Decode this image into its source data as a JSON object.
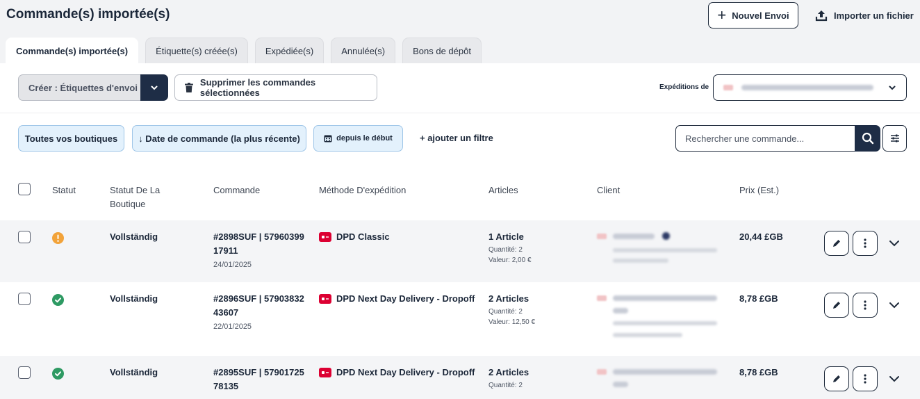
{
  "header": {
    "title": "Commande(s) importée(s)",
    "new_shipment": "Nouvel Envoi",
    "import_file": "Importer un fichier"
  },
  "tabs": [
    {
      "label": "Commande(s) importée(s)",
      "active": true
    },
    {
      "label": "Étiquette(s) créée(s)",
      "active": false
    },
    {
      "label": "Expédiée(s)",
      "active": false
    },
    {
      "label": "Annulée(s)",
      "active": false
    },
    {
      "label": "Bons de dépôt",
      "active": false
    }
  ],
  "toolbar": {
    "create_label": "Créer : Étiquettes d'envoi",
    "delete_label": "Supprimer les commandes sélectionnées",
    "shipments_from_label": "Expéditions de"
  },
  "filters": {
    "shops": "Toutes vos boutiques",
    "sort": "↓ Date de commande (la plus récente)",
    "since": "depuis le début",
    "add_filter": "+ ajouter un filtre",
    "search_placeholder": "Rechercher une commande..."
  },
  "table": {
    "headers": {
      "status": "Statut",
      "shop_status_line1": "Statut De La",
      "shop_status_line2": "Boutique",
      "order": "Commande",
      "shipping_method": "Méthode D'expédition",
      "articles": "Articles",
      "client": "Client",
      "price": "Prix (Est.)"
    },
    "rows": [
      {
        "status": "warning",
        "shop_status": "Vollständig",
        "order_line1": "#2898SUF | 57960399",
        "order_line2": "17911",
        "date": "24/01/2025",
        "method": "DPD Classic",
        "articles": "1 Article",
        "quantity": "Quantité: 2",
        "value": "Valeur: 2,00 €",
        "price": "20,44 £GB"
      },
      {
        "status": "ok",
        "shop_status": "Vollständig",
        "order_line1": "#2896SUF | 57903832",
        "order_line2": "43607",
        "date": "22/01/2025",
        "method": "DPD Next Day Delivery - Dropoff",
        "articles": "2 Articles",
        "quantity": "Quantité: 2",
        "value": "Valeur: 12,50 €",
        "price": "8,78 £GB"
      },
      {
        "status": "ok",
        "shop_status": "Vollständig",
        "order_line1": "#2895SUF | 57901725",
        "order_line2": "78135",
        "date": "",
        "method": "DPD Next Day Delivery - Dropoff",
        "articles": "2 Articles",
        "quantity": "Quantité: 2",
        "value": "",
        "price": "8,78 £GB"
      }
    ]
  },
  "colors": {
    "navy": "#1e2d46",
    "chip_bg": "#e3f1fc",
    "chip_border": "#9fc6e8",
    "warning": "#f2a33a",
    "success": "#2e9a63",
    "dpd_red": "#dc0032"
  }
}
